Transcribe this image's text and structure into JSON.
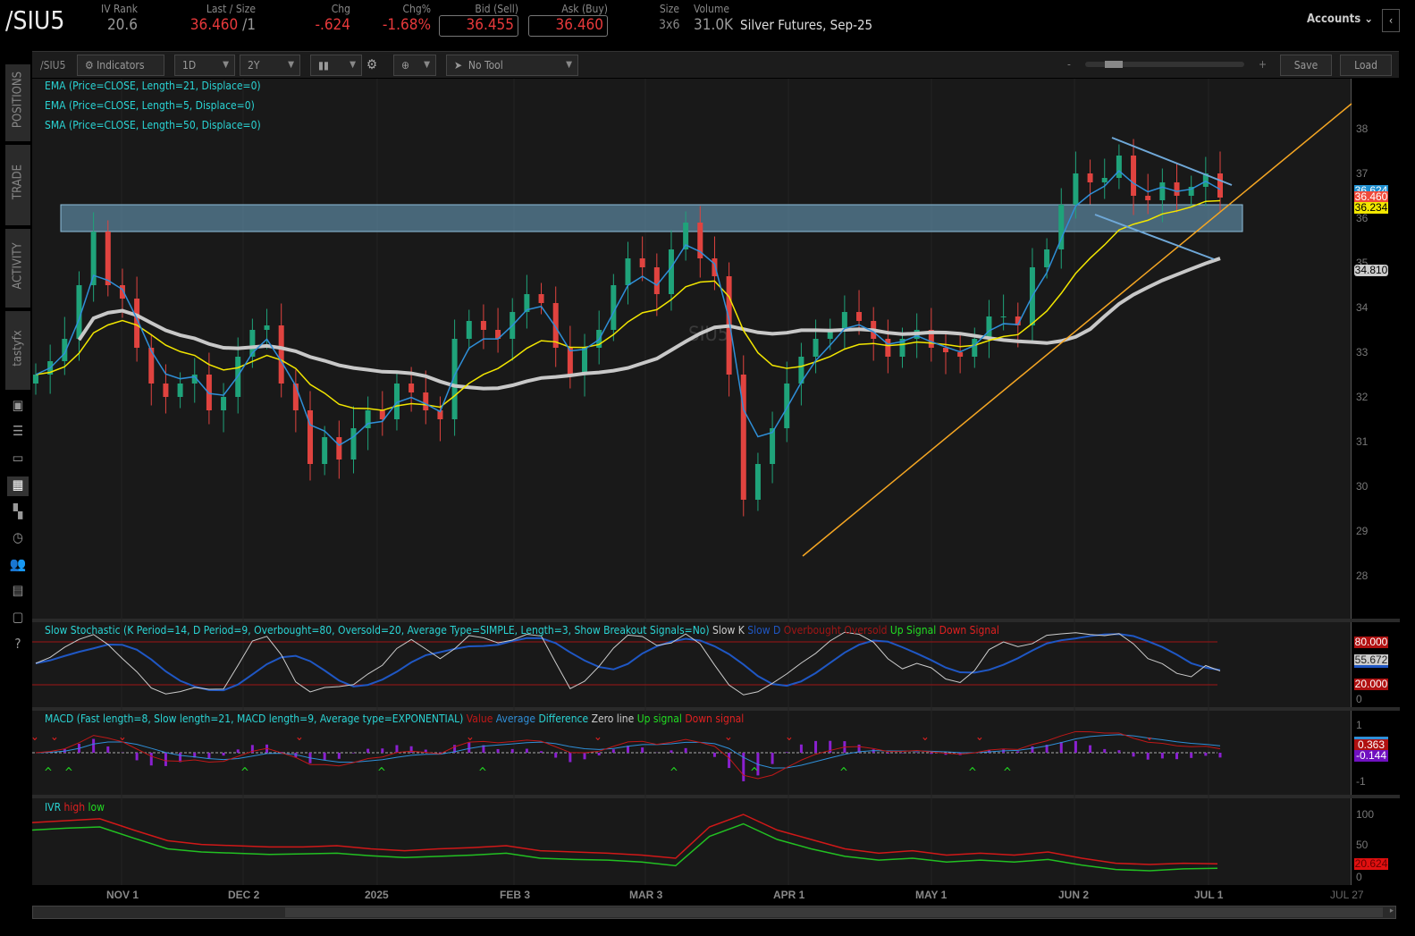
{
  "header": {
    "symbol": "/SIU5",
    "iv_rank_label": "IV Rank",
    "iv_rank": "20.6",
    "last_label": "Last / Size",
    "last": "36.460",
    "last_size": "/1",
    "chg_label": "Chg",
    "chg": "-.624",
    "chgp_label": "Chg%",
    "chgp": "-1.68%",
    "bid_label": "Bid (Sell)",
    "bid": "36.455",
    "ask_label": "Ask (Buy)",
    "ask": "36.460",
    "size_label": "Size",
    "size": "3x6",
    "volume_label": "Volume",
    "volume": "31.0K",
    "description": "Silver Futures, Sep-25",
    "accounts": "Accounts"
  },
  "toolbar": {
    "symbol": "/SIU5",
    "indicators": "Indicators",
    "aggregation": "1D",
    "timeframe": "2Y",
    "tool": "No Tool",
    "zoom_minus": "-",
    "zoom_plus": "+",
    "save": "Save",
    "load": "Load"
  },
  "sidebar": {
    "tabs": [
      "POSITIONS",
      "TRADE",
      "ACTIVITY",
      "tastyfx"
    ]
  },
  "studies": {
    "ema21": "EMA (Price=CLOSE, Length=21, Displace=0)",
    "ema5": "EMA (Price=CLOSE, Length=5, Displace=0)",
    "sma50": "SMA (Price=CLOSE, Length=50, Displace=0)",
    "stoch": "Slow Stochastic (K Period=14, D Period=9, Overbought=80, Oversold=20, Average Type=SIMPLE, Length=3, Show Breakout Signals=No)",
    "stoch_legend": [
      "Slow K",
      "Slow D",
      "Overbought",
      "Oversold",
      "Up Signal",
      "Down Signal"
    ],
    "macd": "MACD (Fast length=8, Slow length=21, MACD length=9, Average type=EXPONENTIAL)",
    "macd_legend": [
      "Value",
      "Average",
      "Difference",
      "Zero line",
      "Up signal",
      "Down signal"
    ],
    "ivr": "IVR",
    "ivr_legend": [
      "high",
      "low"
    ]
  },
  "watermark": "SIU5",
  "tags": {
    "ema5": "36.624",
    "last": "36.460",
    "ema21": "36.234",
    "sma50": "34.810",
    "overbought": "80.000",
    "stoch_k": "55.672",
    "oversold": "20.000",
    "macd_value": "0.363",
    "macd_diff": "-0.144",
    "ivr": "20.624"
  },
  "axes": {
    "price_ticks": [
      "38",
      "37",
      "36",
      "35",
      "34",
      "33",
      "32",
      "31",
      "30",
      "29",
      "28"
    ],
    "stoch_ticks": [
      "0"
    ],
    "macd_ticks": [
      "1",
      "-1"
    ],
    "ivr_ticks": [
      "100",
      "50",
      "0"
    ],
    "date_ticks": [
      "NOV 1",
      "DEC 2",
      "2025",
      "FEB 3",
      "MAR 3",
      "APR 1",
      "MAY 1",
      "JUN 2",
      "JUL 1",
      "JUL 27"
    ]
  },
  "colors": {
    "up": "#1fa37a",
    "down": "#e0433f",
    "ema5": "#2f8fd8",
    "ema21": "#f2e600",
    "sma50": "#c8c8c8",
    "zone": "#6fa8c8",
    "trend": "#f5a623"
  },
  "chart_data": {
    "type": "candlestick",
    "symbol": "/SIU5",
    "ylim": [
      27.5,
      38.8
    ],
    "resistance_zone": [
      35.7,
      36.3
    ],
    "closes": [
      32.5,
      32.8,
      33.3,
      34.5,
      35.7,
      34.5,
      34.2,
      33.1,
      32.3,
      32.0,
      32.3,
      32.5,
      31.7,
      32.0,
      32.9,
      33.5,
      33.6,
      32.3,
      31.7,
      30.5,
      31.1,
      30.6,
      31.3,
      31.7,
      31.5,
      32.3,
      32.1,
      31.7,
      31.5,
      33.3,
      33.7,
      33.5,
      33.3,
      33.9,
      34.3,
      34.1,
      33.1,
      32.5,
      33.1,
      33.5,
      34.5,
      35.1,
      34.9,
      34.3,
      35.3,
      35.9,
      35.1,
      34.7,
      32.5,
      29.7,
      30.5,
      31.3,
      32.3,
      32.9,
      33.3,
      33.5,
      33.9,
      33.7,
      33.3,
      32.9,
      33.3,
      33.5,
      33.1,
      33.0,
      32.9,
      33.3,
      33.8,
      33.8,
      33.6,
      34.9,
      35.3,
      36.3,
      37.0,
      36.8,
      36.9,
      37.4,
      36.5,
      36.4,
      36.8,
      36.5,
      36.7,
      37.0,
      36.46
    ],
    "ivr_high": [
      87,
      90,
      93,
      75,
      58,
      52,
      50,
      48,
      48,
      50,
      45,
      42,
      45,
      47,
      50,
      42,
      40,
      38,
      35,
      30,
      80,
      100,
      75,
      60,
      45,
      38,
      42,
      35,
      38,
      35,
      40,
      30,
      22,
      20,
      22,
      21
    ],
    "ivr_low": [
      75,
      78,
      80,
      62,
      45,
      40,
      38,
      36,
      37,
      38,
      34,
      31,
      33,
      35,
      38,
      30,
      28,
      27,
      24,
      18,
      65,
      85,
      60,
      45,
      33,
      27,
      30,
      24,
      27,
      24,
      28,
      19,
      12,
      10,
      13,
      14
    ]
  }
}
